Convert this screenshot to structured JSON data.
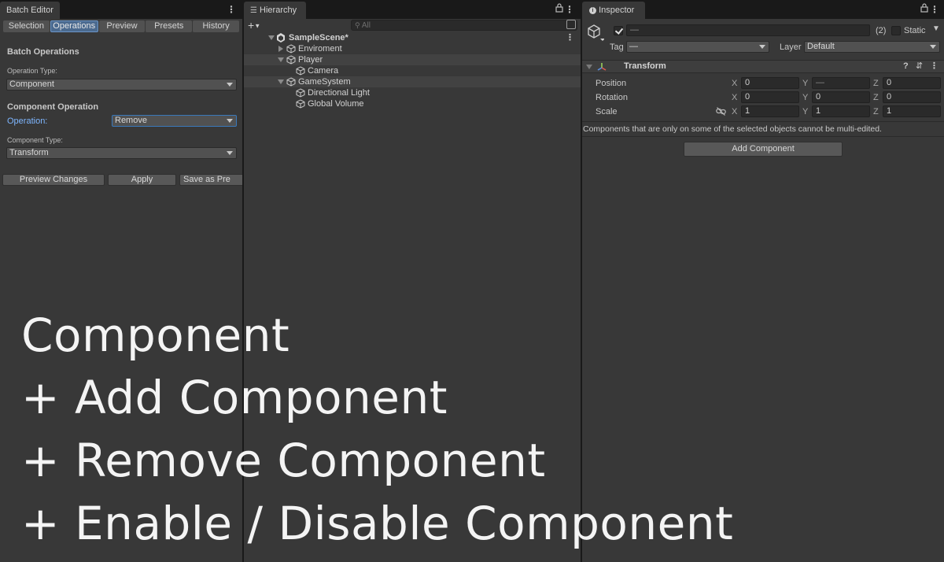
{
  "batch_editor": {
    "tab_title": "Batch Editor",
    "subtabs": [
      "Selection",
      "Operations",
      "Preview",
      "Presets",
      "History"
    ],
    "active_subtab": "Operations",
    "section_title": "Batch Operations",
    "operation_type_label": "Operation Type:",
    "operation_type_value": "Component",
    "component_operation_title": "Component Operation",
    "operation_label": "Operation:",
    "operation_value": "Remove",
    "component_type_label": "Component Type:",
    "component_type_value": "Transform",
    "buttons": {
      "preview_changes": "Preview Changes",
      "apply": "Apply",
      "save_as_preset": "Save as Pre"
    }
  },
  "hierarchy": {
    "tab_title": "Hierarchy",
    "add_button": "+",
    "search_placeholder": "All",
    "scene_name": "SampleScene*",
    "items": [
      {
        "label": "Enviroment",
        "depth": 1,
        "arrow": "right",
        "alt": false
      },
      {
        "label": "Player",
        "depth": 1,
        "arrow": "down",
        "alt": true
      },
      {
        "label": "Camera",
        "depth": 2,
        "arrow": "none",
        "alt": false
      },
      {
        "label": "GameSystem",
        "depth": 1,
        "arrow": "down",
        "alt": true
      },
      {
        "label": "Directional Light",
        "depth": 2,
        "arrow": "none",
        "alt": false
      },
      {
        "label": "Global Volume",
        "depth": 2,
        "arrow": "none",
        "alt": false
      }
    ]
  },
  "inspector": {
    "tab_title": "Inspector",
    "name_value": "—",
    "selection_count": "(2)",
    "static_label": "Static",
    "tag_label": "Tag",
    "tag_value": "—",
    "layer_label": "Layer",
    "layer_value": "Default",
    "transform_title": "Transform",
    "position_label": "Position",
    "rotation_label": "Rotation",
    "scale_label": "Scale",
    "axis": {
      "x": "X",
      "y": "Y",
      "z": "Z"
    },
    "position": {
      "x": "0",
      "y": "—",
      "z": "0"
    },
    "rotation": {
      "x": "0",
      "y": "0",
      "z": "0"
    },
    "scale": {
      "x": "1",
      "y": "1",
      "z": "1"
    },
    "multi_edit_note": "Components that are only on some of the selected objects cannot be multi-edited.",
    "add_component_button": "Add Component"
  },
  "overlay": {
    "line1": "Component",
    "line2": "+ Add Component",
    "line3": "+ Remove Component",
    "line4": "+ Enable / Disable Component"
  },
  "colors": {
    "panel_bg": "#383838",
    "accent_blue": "#7eb6ff",
    "active_tab": "#4b6a8f"
  }
}
